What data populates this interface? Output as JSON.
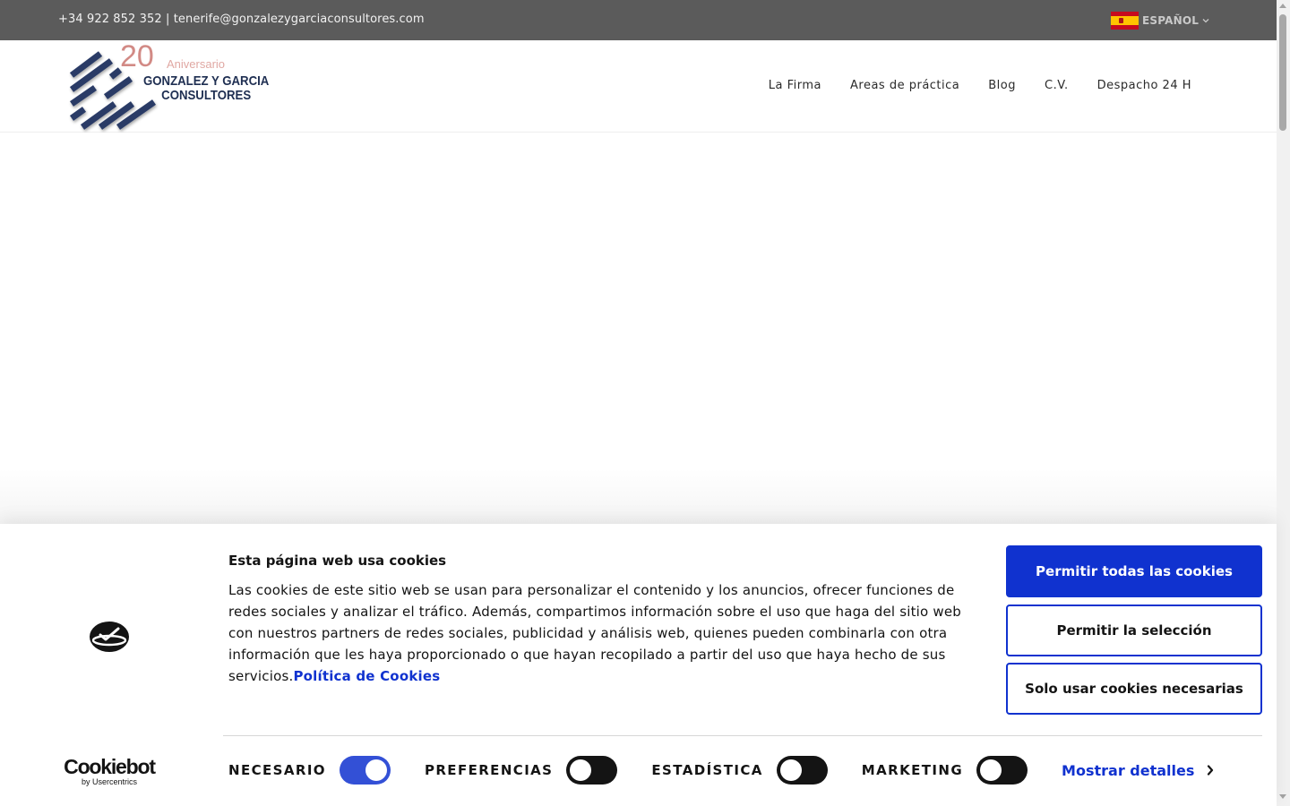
{
  "topbar": {
    "contact": "+34 922 852 352 | tenerife@gonzalezygarciaconsultores.com",
    "language": {
      "label": "ESPAÑOL",
      "flag_icon": "spain-flag-icon",
      "chevron_icon": "chevron-down-icon"
    }
  },
  "logo": {
    "number": "20",
    "tagline": "Aniversario",
    "name_line1": "GONZALEZ Y GARCIA",
    "name_line2": "CONSULTORES"
  },
  "nav": {
    "items": [
      "La Firma",
      "Areas de práctica",
      "Blog",
      "C.V.",
      "Despacho 24 H"
    ]
  },
  "cookie_banner": {
    "brand_icon": "cookiebot-icon",
    "brand": "Cookiebot",
    "brand_sub": "by Usercentrics",
    "title": "Esta página web usa cookies",
    "text": "Las cookies de este sitio web se usan para personalizar el contenido y los anuncios, ofrecer funciones de redes sociales y analizar el tráfico. Además, compartimos información sobre el uso que haga del sitio web con nuestros partners de redes sociales, publicidad y análisis web, quienes pueden combinarla con otra información que les haya proporcionado o que hayan recopilado a partir del uso que haya hecho de sus servicios.",
    "policy_link": "Política de Cookies",
    "buttons": {
      "allow_all": "Permitir todas las cookies",
      "allow_selection": "Permitir la selección",
      "necessary_only": "Solo usar cookies necesarias"
    },
    "toggles": [
      {
        "label": "NECESARIO",
        "checked": true
      },
      {
        "label": "PREFERENCIAS",
        "checked": false
      },
      {
        "label": "ESTADÍSTICA",
        "checked": false
      },
      {
        "label": "MARKETING",
        "checked": false
      }
    ],
    "details_link": "Mostrar detalles",
    "details_icon": "chevron-right-icon"
  },
  "colors": {
    "topbar_bg": "#5b5b5b",
    "accent_blue": "#1032cf",
    "logo_navy": "#1f2f52",
    "logo_pink": "#d28a85",
    "toggle_off": "#141414"
  }
}
